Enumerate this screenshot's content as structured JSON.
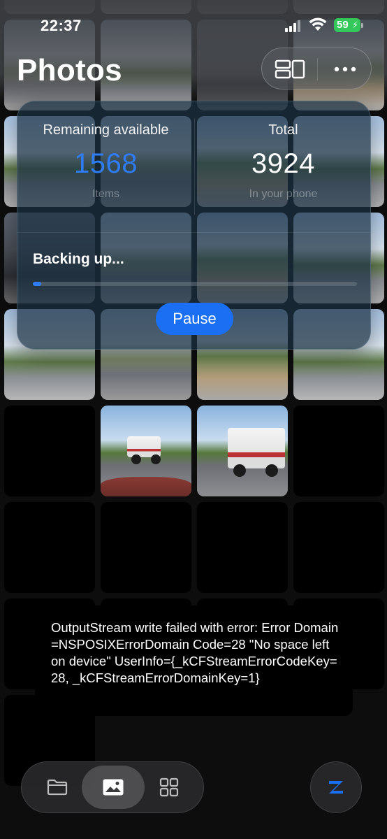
{
  "status_bar": {
    "time": "22:37",
    "battery_percent": "59",
    "battery_color": "#34c759"
  },
  "header": {
    "title": "Photos",
    "layout_icon": "layout-toggle-icon",
    "more_icon": "more-ellipsis-icon"
  },
  "backup_card": {
    "remaining": {
      "label": "Remaining available",
      "value": "1568",
      "unit": "Items",
      "color": "#2f7df6"
    },
    "total": {
      "label": "Total",
      "value": "3924",
      "unit": "In your phone"
    },
    "status_text": "Backing up...",
    "progress_fraction": 0.025,
    "pause_label": "Pause"
  },
  "error_toast": {
    "message": "OutputStream write failed with error: Error Domain=NSPOSIXErrorDomain Code=28 \"No space left on device\" UserInfo={_kCFStreamErrorCodeKey=28, _kCFStreamErrorDomainKey=1}"
  },
  "tab_bar": {
    "tabs": [
      {
        "icon": "folder-icon",
        "active": false
      },
      {
        "icon": "photo-icon",
        "active": true
      },
      {
        "icon": "grid-icon",
        "active": false
      }
    ],
    "app_button_icon": "z-logo-icon",
    "accent": "#1a6ff2"
  }
}
